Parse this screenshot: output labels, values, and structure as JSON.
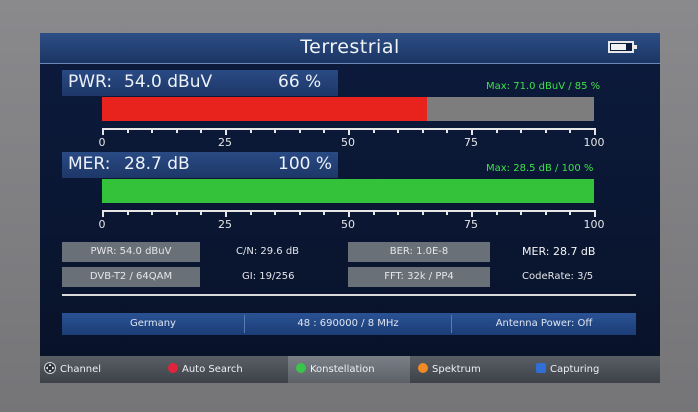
{
  "title": "Terrestrial",
  "battery": {
    "level": 0.8
  },
  "pwr": {
    "label": "PWR:",
    "value": "54.0 dBuV",
    "percent_text": "66 %",
    "percent": 66,
    "max": "Max: 71.0 dBuV / 85 %",
    "color": "#e8221c"
  },
  "mer": {
    "label": "MER:",
    "value": "28.7 dB",
    "percent_text": "100 %",
    "percent": 100,
    "max": "Max: 28.5 dB / 100 %",
    "color": "#33c23a"
  },
  "scale_labels": [
    "0",
    "25",
    "50",
    "75",
    "100"
  ],
  "info": {
    "pwr": "PWR: 54.0 dBuV",
    "cn": "C/N: 29.6 dB",
    "ber": "BER: 1.0E-8",
    "mer": "MER: 28.7 dB",
    "mode": "DVB-T2 / 64QAM",
    "gi": "GI: 19/256",
    "fft": "FFT: 32k / PP4",
    "coderate": "CodeRate: 3/5"
  },
  "bottom": {
    "country": "Germany",
    "channel": "48 : 690000 / 8 MHz",
    "antenna": "Antenna Power: Off"
  },
  "softkeys": {
    "channel": "Channel",
    "auto_search": "Auto Search",
    "konstellation": "Konstellation",
    "spektrum": "Spektrum",
    "capturing": "Capturing"
  },
  "colors": {
    "red_key": "#e0243a",
    "green_key": "#39c44a",
    "orange_key": "#f08a24",
    "blue_key": "#2f6fd6"
  }
}
